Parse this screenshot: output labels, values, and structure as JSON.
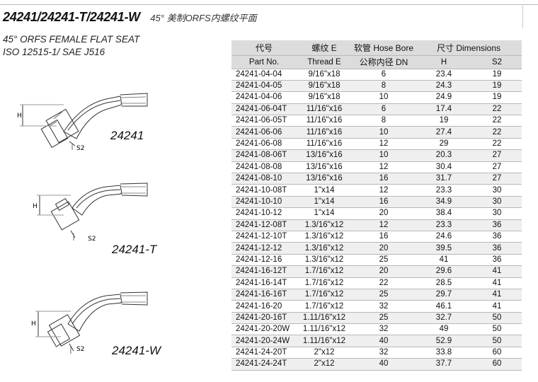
{
  "header": {
    "title": "24241/24241-T/24241-W",
    "title_cn": "45° 美制ORFS内螺纹平面",
    "subtitle": "45° ORFS FEMALE FLAT SEAT",
    "standard": "ISO 12515-1/ SAE J516"
  },
  "drawings": [
    {
      "code": "24241",
      "dim_h": "H",
      "dim_s2": "S2"
    },
    {
      "code": "24241-T",
      "dim_h": "H",
      "dim_s2": "S2"
    },
    {
      "code": "24241-W",
      "dim_h": "H",
      "dim_s2": "S2"
    }
  ],
  "table": {
    "headers": {
      "part_no_cn": "代号",
      "part_no": "Part No.",
      "thread_cn": "螺纹 E",
      "thread": "Thread E",
      "hose_bore": "软管 Hose Bore",
      "dn": "公称内径 DN",
      "dimensions": "尺寸 Dimensions",
      "h": "H",
      "s2": "S2"
    },
    "rows": [
      [
        "24241-04-04",
        "9/16\"x18",
        "6",
        "23.4",
        "19"
      ],
      [
        "24241-04-05",
        "9/16\"x18",
        "8",
        "24.3",
        "19"
      ],
      [
        "24241-04-06",
        "9/16\"x18",
        "10",
        "24.9",
        "19"
      ],
      [
        "24241-06-04T",
        "11/16\"x16",
        "6",
        "17.4",
        "22"
      ],
      [
        "24241-06-05T",
        "11/16\"x16",
        "8",
        "19",
        "22"
      ],
      [
        "24241-06-06",
        "11/16\"x16",
        "10",
        "27.4",
        "22"
      ],
      [
        "24241-06-08",
        "11/16\"x16",
        "12",
        "29",
        "22"
      ],
      [
        "24241-08-06T",
        "13/16\"x16",
        "10",
        "20.3",
        "27"
      ],
      [
        "24241-08-08",
        "13/16\"x16",
        "12",
        "30.4",
        "27"
      ],
      [
        "24241-08-10",
        "13/16\"x16",
        "16",
        "31.7",
        "27"
      ],
      [
        "24241-10-08T",
        "1\"x14",
        "12",
        "23.3",
        "30"
      ],
      [
        "24241-10-10",
        "1\"x14",
        "16",
        "34.9",
        "30"
      ],
      [
        "24241-10-12",
        "1\"x14",
        "20",
        "38.4",
        "30"
      ],
      [
        "24241-12-08T",
        "1.3/16\"x12",
        "12",
        "23.3",
        "36"
      ],
      [
        "24241-12-10T",
        "1.3/16\"x12",
        "16",
        "24.6",
        "36"
      ],
      [
        "24241-12-12",
        "1.3/16\"x12",
        "20",
        "39.5",
        "36"
      ],
      [
        "24241-12-16",
        "1.3/16\"x12",
        "25",
        "41",
        "36"
      ],
      [
        "24241-16-12T",
        "1.7/16\"x12",
        "20",
        "29.6",
        "41"
      ],
      [
        "24241-16-14T",
        "1.7/16\"x12",
        "22",
        "28.5",
        "41"
      ],
      [
        "24241-16-16T",
        "1.7/16\"x12",
        "25",
        "29.7",
        "41"
      ],
      [
        "24241-16-20",
        "1.7/16\"x12",
        "32",
        "46.1",
        "41"
      ],
      [
        "24241-20-16T",
        "1.11/16\"x12",
        "25",
        "32.7",
        "50"
      ],
      [
        "24241-20-20W",
        "1.11/16\"x12",
        "32",
        "49",
        "50"
      ],
      [
        "24241-20-24W",
        "1.11/16\"x12",
        "40",
        "52.9",
        "50"
      ],
      [
        "24241-24-20T",
        "2\"x12",
        "32",
        "33.8",
        "60"
      ],
      [
        "24241-24-24T",
        "2\"x12",
        "40",
        "37.7",
        "60"
      ]
    ]
  }
}
